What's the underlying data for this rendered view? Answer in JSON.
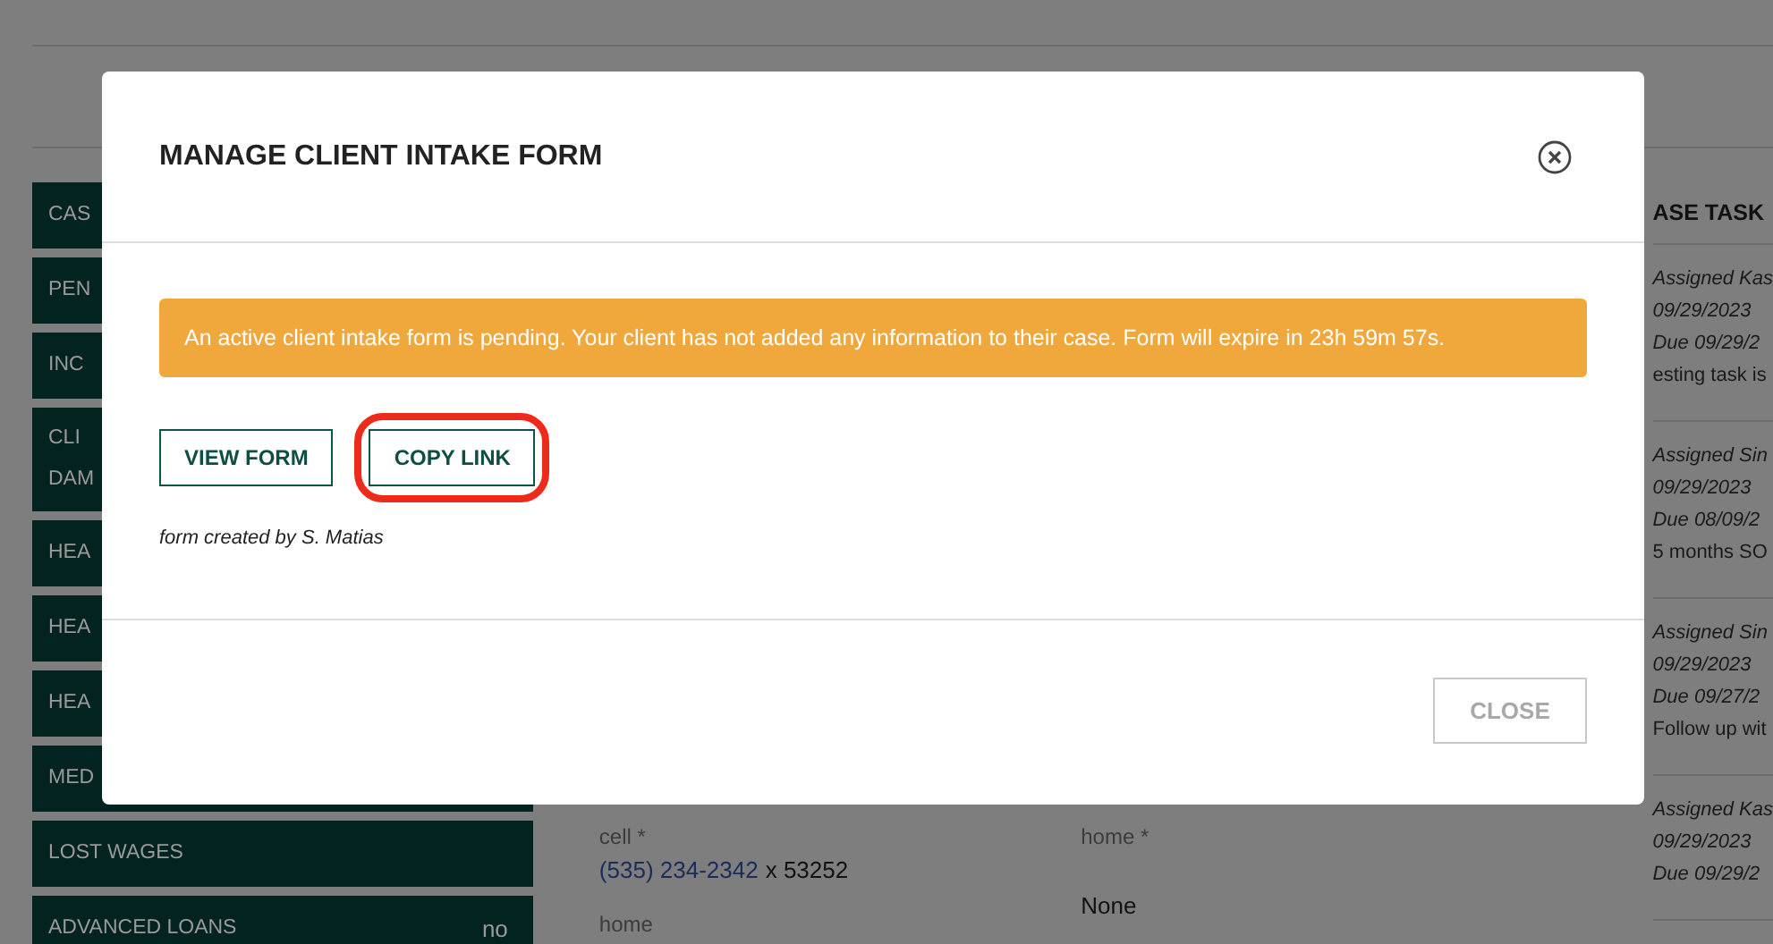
{
  "sidebar": {
    "items": [
      {
        "label": "CAS"
      },
      {
        "label": "PEN"
      },
      {
        "label": "INC"
      },
      {
        "label": "CLI\nDAM"
      },
      {
        "label": "HEA"
      },
      {
        "label": "HEA"
      },
      {
        "label": "HEA"
      },
      {
        "label": "MED"
      },
      {
        "label": "LOST WAGES"
      },
      {
        "label": "ADVANCED LOANS",
        "value": "no"
      }
    ]
  },
  "contact": {
    "columns": [
      {
        "label": "cell *",
        "phone": "(535) 234-2342",
        "extension": "x 53252",
        "next_label": "home"
      },
      {
        "label": "home *",
        "value": "None"
      }
    ]
  },
  "tasks": {
    "heading": "ASE TASK",
    "items": [
      {
        "assigned": "Assigned Kas",
        "date": "09/29/2023",
        "due": "Due 09/29/2",
        "note": "esting task is"
      },
      {
        "assigned": "Assigned Sin",
        "date": "09/29/2023",
        "due": "Due 08/09/2",
        "note": "5 months SO"
      },
      {
        "assigned": "Assigned Sin",
        "date": "09/29/2023",
        "due": "Due 09/27/2",
        "note": "Follow up wit"
      },
      {
        "assigned": "Assigned Kas",
        "date": "09/29/2023",
        "due": "Due 09/29/2"
      }
    ]
  },
  "modal": {
    "title": "MANAGE CLIENT INTAKE FORM",
    "alert": "An active client intake form is pending. Your client has not added any information to their case. Form will expire in 23h 59m 57s.",
    "buttons": [
      {
        "label": "VIEW FORM",
        "highlighted": false
      },
      {
        "label": "COPY LINK",
        "highlighted": true
      }
    ],
    "caption": "form created by S. Matias",
    "close_button": {
      "label": "CLOSE",
      "disabled": true
    }
  }
}
